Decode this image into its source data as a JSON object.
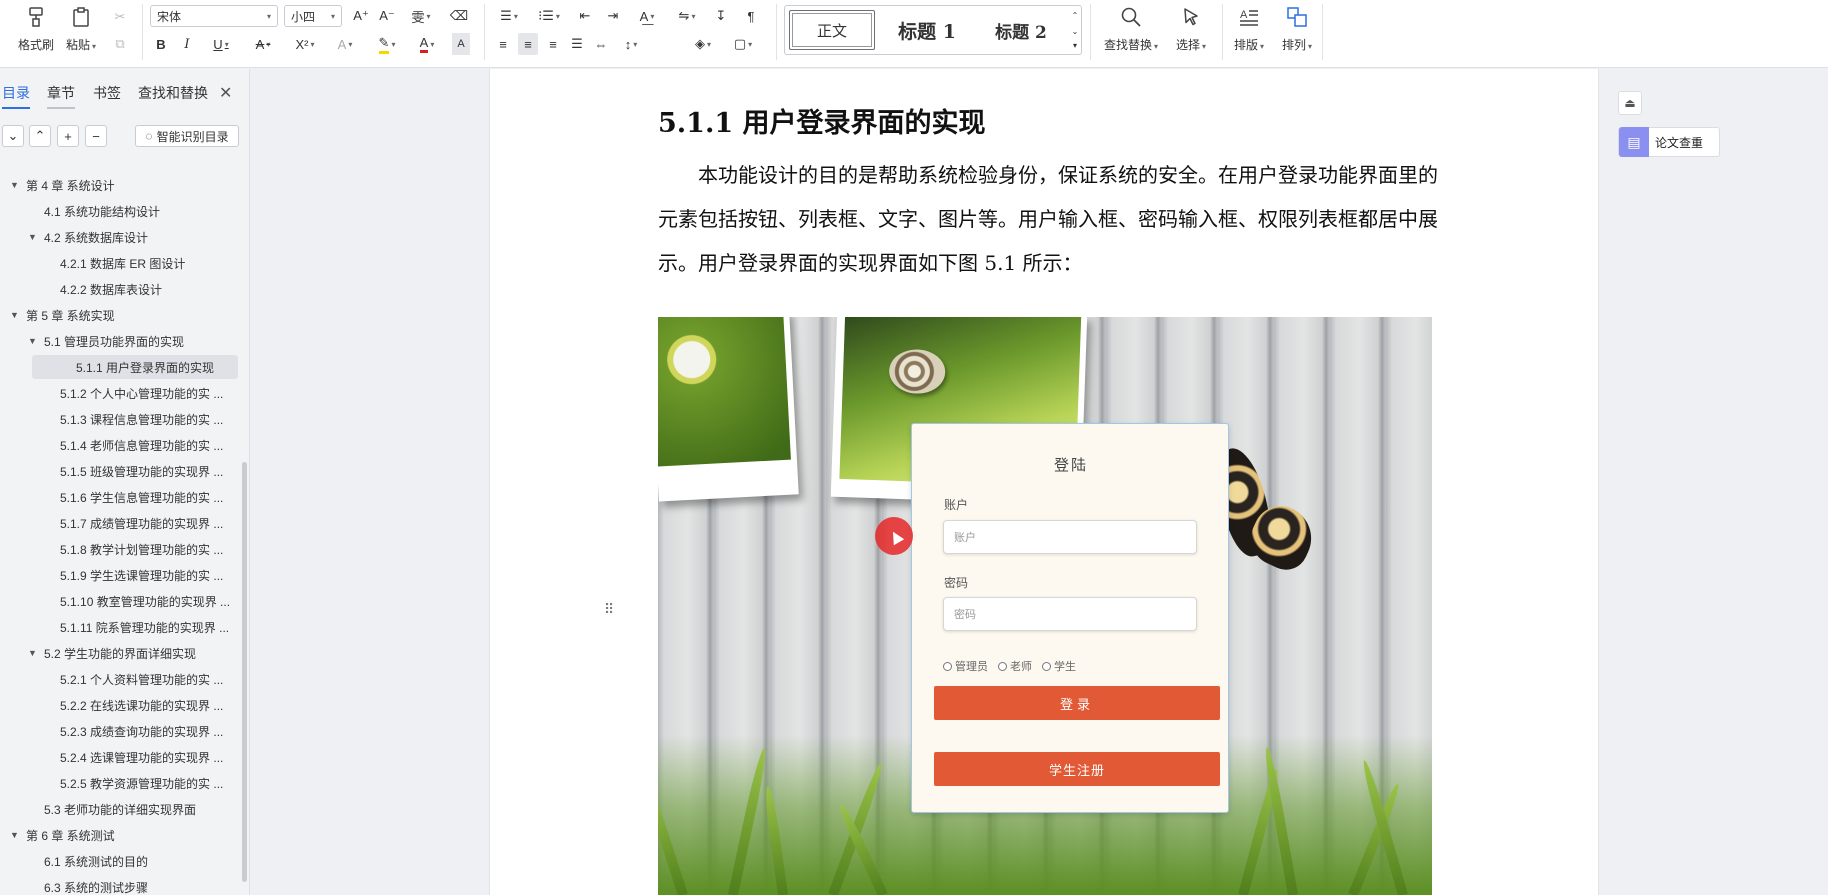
{
  "ribbon": {
    "format_painter": "格式刷",
    "paste": "粘贴",
    "font_name": "宋体",
    "font_size": "小四",
    "styles": [
      "正文",
      "标题 1",
      "标题 2"
    ],
    "find_replace": "查找替换",
    "select": "选择",
    "layout": "排版",
    "arrange": "排列"
  },
  "nav": {
    "tabs": [
      "目录",
      "章节",
      "书签",
      "查找和替换"
    ],
    "smart_toc": "智能识别目录",
    "toc": [
      {
        "text": "第 4 章  系统设计",
        "level": 0,
        "expanded": true
      },
      {
        "text": "4.1 系统功能结构设计",
        "level": 1
      },
      {
        "text": "4.2 系统数据库设计",
        "level": 1,
        "expanded": true
      },
      {
        "text": "4.2.1 数据库 ER 图设计",
        "level": 2
      },
      {
        "text": "4.2.2 数据库表设计",
        "level": 2
      },
      {
        "text": "第 5 章  系统实现",
        "level": 0,
        "expanded": true
      },
      {
        "text": "5.1 管理员功能界面的实现",
        "level": 1,
        "expanded": true
      },
      {
        "text": "5.1.1 用户登录界面的实现",
        "level": 2,
        "selected": true
      },
      {
        "text": "5.1.2 个人中心管理功能的实 ...",
        "level": 2
      },
      {
        "text": "5.1.3 课程信息管理功能的实 ...",
        "level": 2
      },
      {
        "text": "5.1.4 老师信息管理功能的实 ...",
        "level": 2
      },
      {
        "text": "5.1.5 班级管理功能的实现界 ...",
        "level": 2
      },
      {
        "text": "5.1.6 学生信息管理功能的实 ...",
        "level": 2
      },
      {
        "text": "5.1.7 成绩管理功能的实现界 ...",
        "level": 2
      },
      {
        "text": "5.1.8 教学计划管理功能的实 ...",
        "level": 2
      },
      {
        "text": "5.1.9 学生选课管理功能的实 ...",
        "level": 2
      },
      {
        "text": "5.1.10 教室管理功能的实现界 ...",
        "level": 2
      },
      {
        "text": "5.1.11 院系管理功能的实现界 ...",
        "level": 2
      },
      {
        "text": "5.2 学生功能的界面详细实现",
        "level": 1,
        "expanded": true
      },
      {
        "text": "5.2.1 个人资料管理功能的实 ...",
        "level": 2
      },
      {
        "text": "5.2.2 在线选课功能的实现界 ...",
        "level": 2
      },
      {
        "text": "5.2.3 成绩查询功能的实现界 ...",
        "level": 2
      },
      {
        "text": "5.2.4 选课管理功能的实现界 ...",
        "level": 2
      },
      {
        "text": "5.2.5 教学资源管理功能的实 ...",
        "level": 2
      },
      {
        "text": "5.3 老师功能的详细实现界面",
        "level": 1
      },
      {
        "text": "第 6 章  系统测试",
        "level": 0,
        "expanded": true
      },
      {
        "text": "6.1 系统测试的目的",
        "level": 1
      },
      {
        "text": "6.3 系统的测试步骤",
        "level": 1
      }
    ]
  },
  "doc": {
    "heading": "5.1.1 用户登录界面的实现",
    "paragraph": "本功能设计的目的是帮助系统检验身份，保证系统的安全。在用户登录功能界面里的元素包括按钮、列表框、文字、图片等。用户输入框、密码输入框、权限列表框都居中展示。用户登录界面的实现界面如下图 5.1 所示："
  },
  "login": {
    "title": "登陆",
    "account_label": "账户",
    "account_placeholder": "账户",
    "password_label": "密码",
    "password_placeholder": "密码",
    "roles": [
      "管理员",
      "老师",
      "学生"
    ],
    "login_button": "登录",
    "register_button": "学生注册"
  },
  "right": {
    "paper_check": "论文查重"
  }
}
